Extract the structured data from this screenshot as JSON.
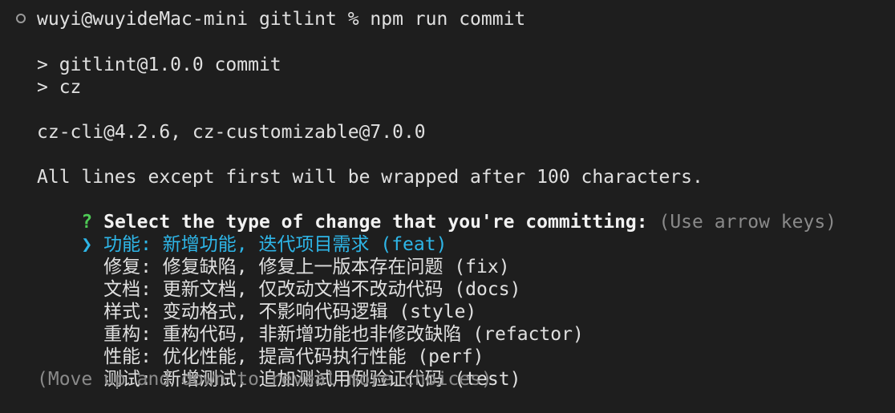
{
  "terminal": {
    "prompt_line": "wuyi@wuyideMac-mini gitlint % npm run commit",
    "output": {
      "run_line_1": "> gitlint@1.0.0 commit",
      "run_line_2": "> cz",
      "version_line": "cz-cli@4.2.6, cz-customizable@7.0.0",
      "wrap_notice": "All lines except first will be wrapped after 100 characters."
    },
    "question": {
      "mark": "?",
      "text": "Select the type of change that you're committing:",
      "hint": "(Use arrow keys)"
    },
    "pointer": "❯",
    "options": [
      {
        "label": "功能: 新增功能, 迭代项目需求 (feat)",
        "selected": true
      },
      {
        "label": "修复: 修复缺陷, 修复上一版本存在问题 (fix)",
        "selected": false
      },
      {
        "label": "文档: 更新文档, 仅改动文档不改动代码 (docs)",
        "selected": false
      },
      {
        "label": "样式: 变动格式, 不影响代码逻辑 (style)",
        "selected": false
      },
      {
        "label": "重构: 重构代码, 非新增功能也非修改缺陷 (refactor)",
        "selected": false
      },
      {
        "label": "性能: 优化性能, 提高代码执行性能 (perf)",
        "selected": false
      },
      {
        "label": "测试: 新增测试, 追加测试用例验证代码 (test)",
        "selected": false
      }
    ],
    "footer_hint": "(Move up and down to reveal more choices)",
    "colors": {
      "background": "#1e1e1e",
      "text": "#e0e0e0",
      "question_mark": "#4ec955",
      "selected": "#2eb6e8",
      "dim": "#8a8a8a"
    }
  }
}
